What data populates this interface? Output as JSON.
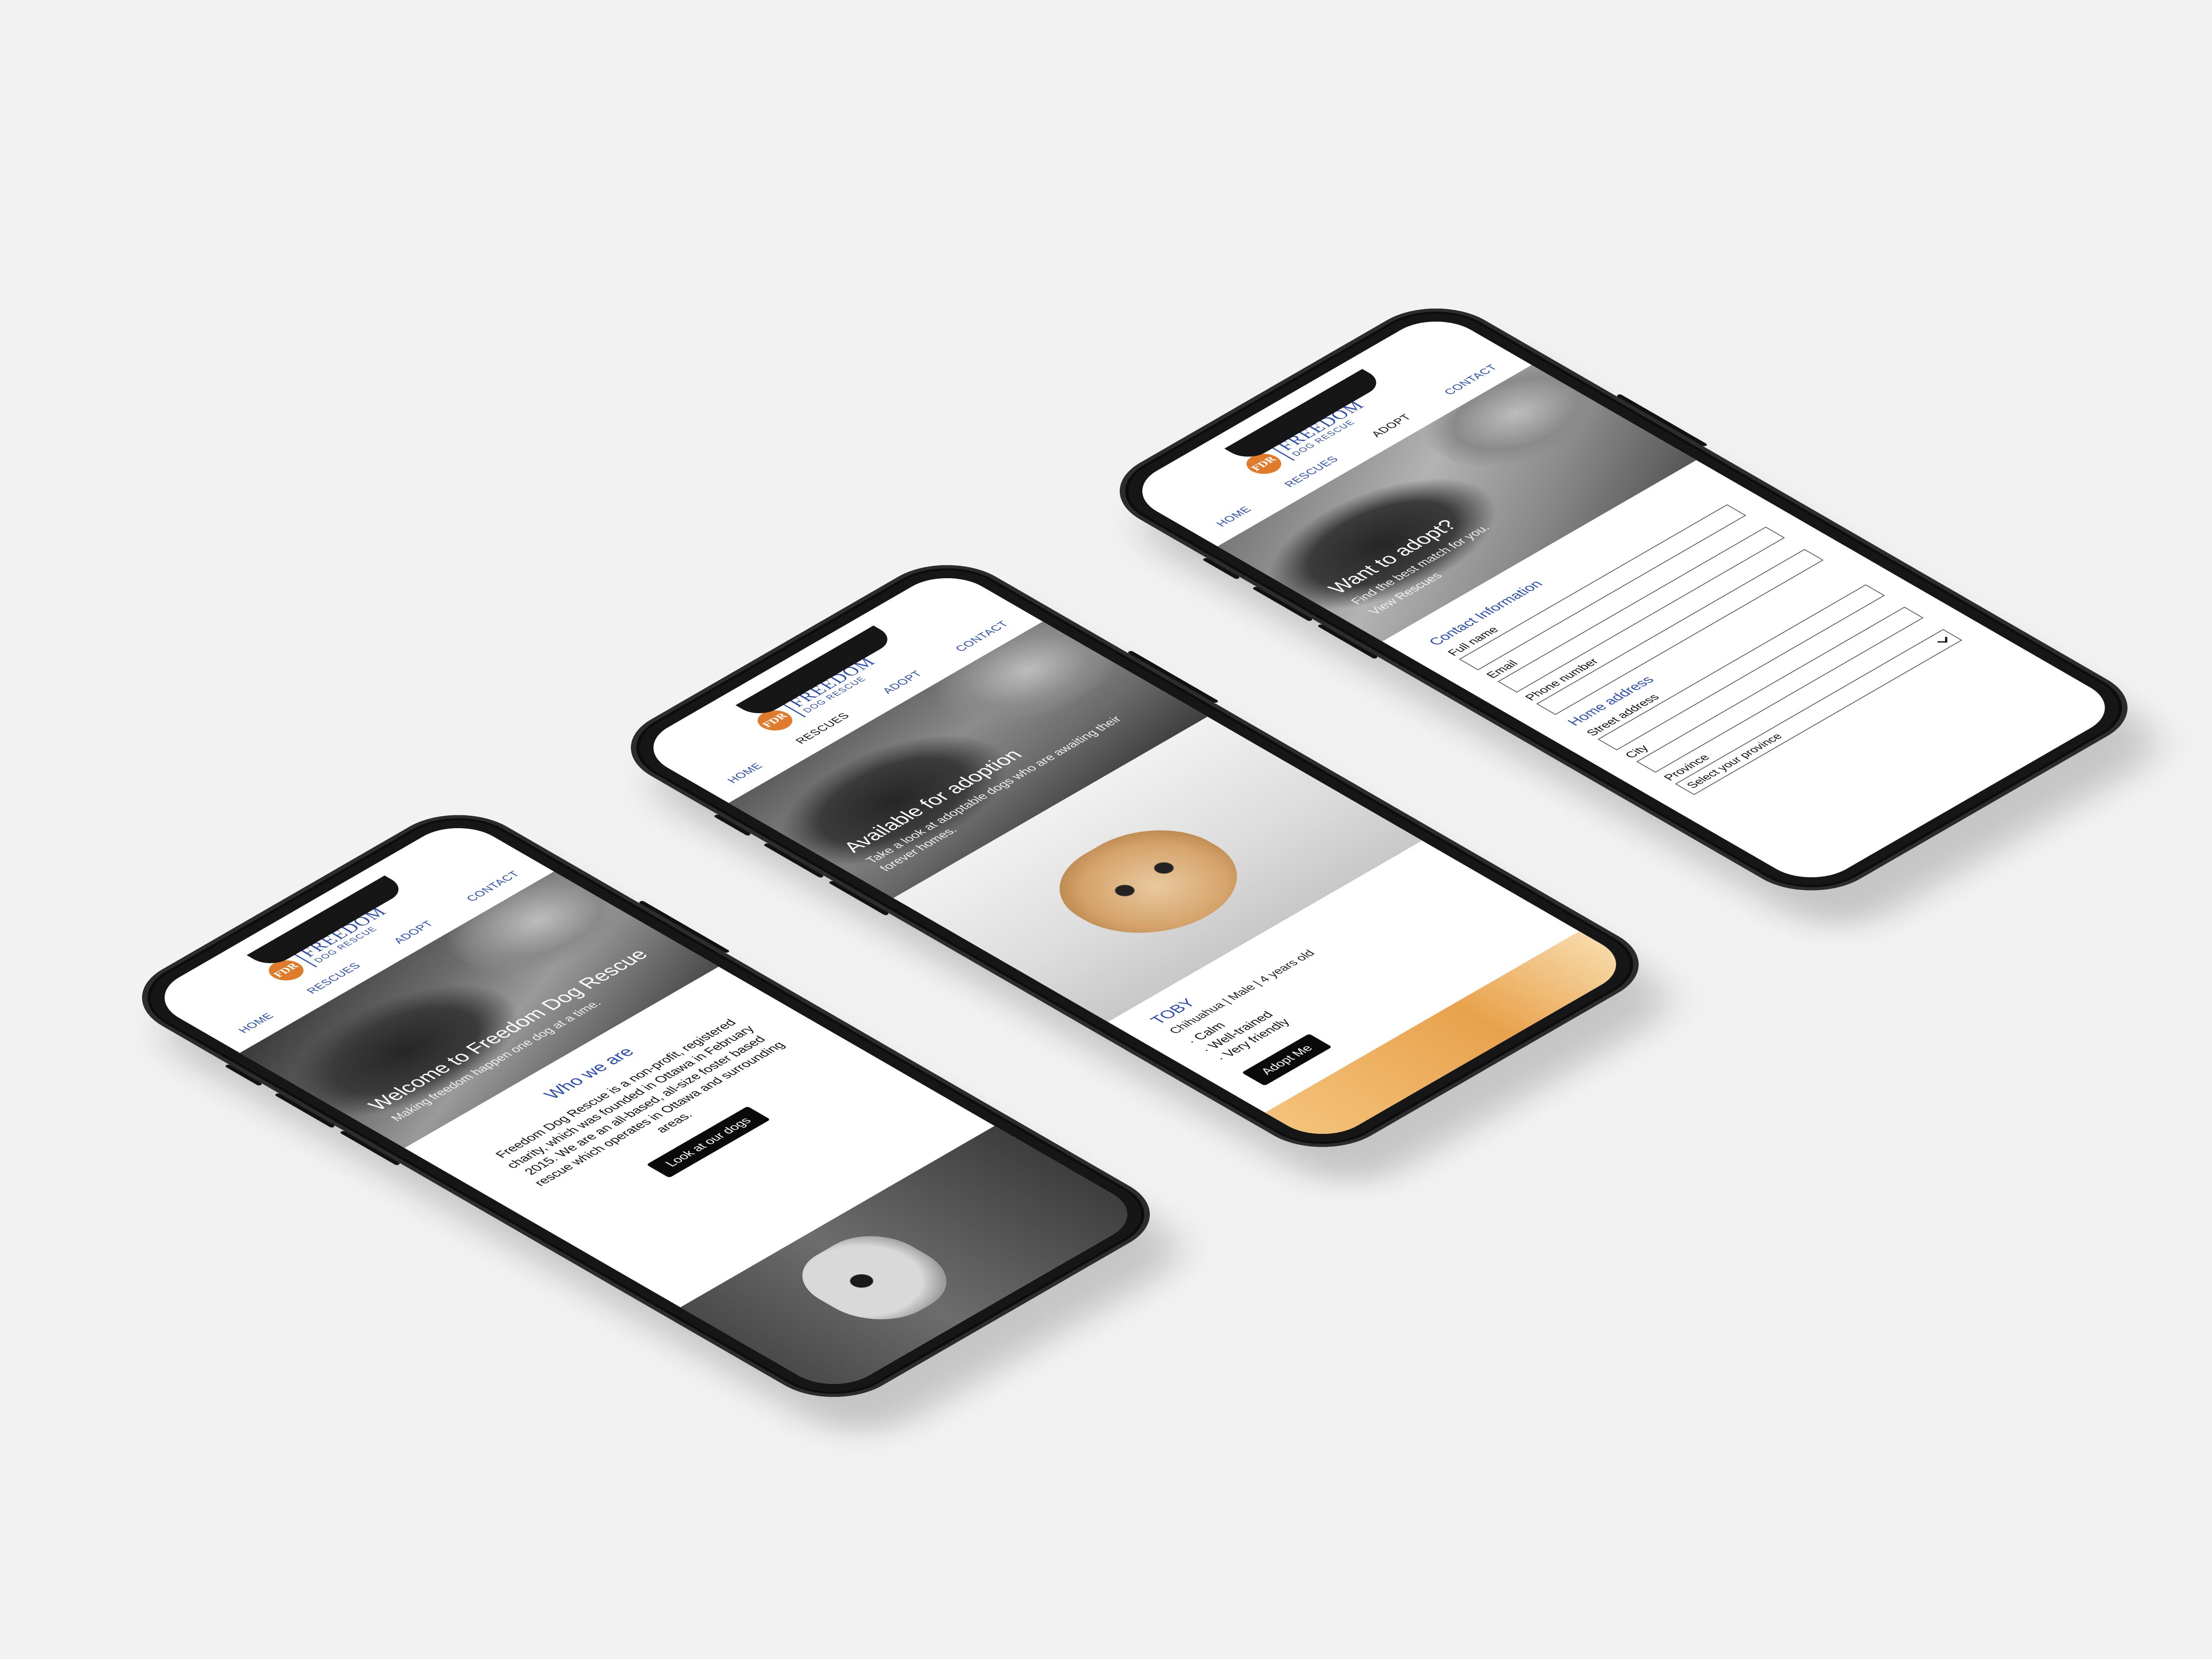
{
  "brand": {
    "badge": "FDR",
    "word": "FREEDOM",
    "sub": "DOG RESCUE",
    "accent_color": "#2b4eb0",
    "badge_color": "#e07b2b"
  },
  "nav": {
    "home": "HOME",
    "rescues": "RESCUES",
    "adopt": "ADOPT",
    "contact": "CONTACT"
  },
  "home": {
    "hero_title": "Welcome to Freedom Dog Rescue",
    "hero_sub": "Making freedom happen one dog at a time.",
    "section_title": "Who we are",
    "body": "Freedom Dog Rescue is a non-profit, registered charity, which was founded in Ottawa in February 2015. We are an all-based, all-size foster based rescue which operates in Ottawa and surrounding areas.",
    "cta": "Look at our dogs"
  },
  "rescues": {
    "hero_title": "Available for adoption",
    "hero_sub": "Take a look at adoptable dogs who are awaiting their forever homes.",
    "dog": {
      "name": "TOBY",
      "meta": "Chihuahua | Male | 4 years old",
      "traits": [
        "· Calm",
        "· Well-trained",
        "· Very friendly"
      ],
      "cta": "Adopt Me"
    }
  },
  "adopt": {
    "hero_title": "Want to adopt?",
    "hero_sub": "Find the best match for you.",
    "hero_link": "View Rescues",
    "contact_title": "Contact Information",
    "full_name": "Full name",
    "email": "Email",
    "phone": "Phone number",
    "address_title": "Home address",
    "street": "Street address",
    "city": "City",
    "province": "Province",
    "province_placeholder": "Select your province"
  }
}
